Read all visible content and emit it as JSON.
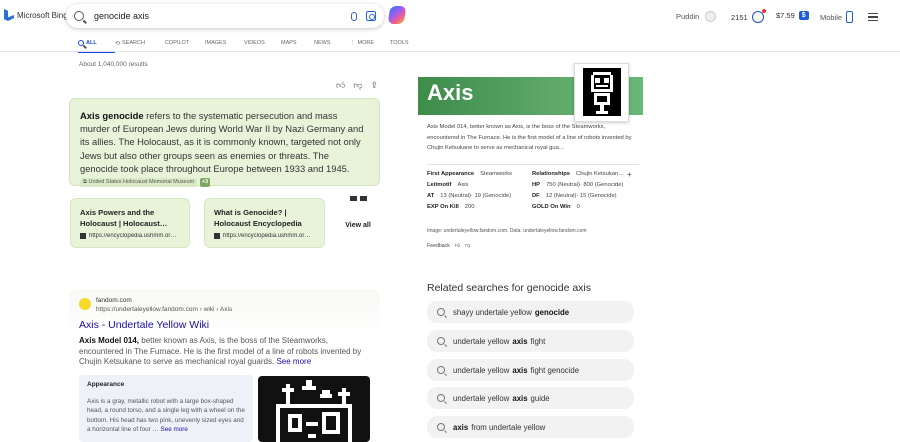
{
  "header": {
    "logo_text": "Microsoft Bing",
    "query": "genocide axis",
    "user_name": "Puddin",
    "rewards_points": "2151",
    "balance": "$7.59",
    "balance_badge": "$",
    "mobile_label": "Mobile"
  },
  "tabs": [
    {
      "label": "ALL",
      "icon": "search-icon"
    },
    {
      "label": "SEARCH",
      "icon": "copilot-search-icon"
    },
    {
      "label": "COPILOT",
      "icon": ""
    },
    {
      "label": "IMAGES",
      "icon": ""
    },
    {
      "label": "VIDEOS",
      "icon": ""
    },
    {
      "label": "MAPS",
      "icon": ""
    },
    {
      "label": "NEWS",
      "icon": ""
    },
    {
      "label": "MORE",
      "icon": "more-vertical-icon"
    },
    {
      "label": "TOOLS",
      "icon": ""
    }
  ],
  "results_count": "About 1,040,000 results",
  "answer": {
    "term": "Axis genocide",
    "text": " refers to the systematic persecution and mass murder of European Jews during World War II by Nazi Germany and its allies. The Holocaust, as it is commonly known, targeted not only Jews but also other groups seen as enemies or threats. The genocide took place throughout Europe between 1933 and 1945.",
    "source": "United States Holocaust Memorial Museum",
    "more": "+3"
  },
  "cards": [
    {
      "title": "Axis Powers and the Holocaust | Holocaust…",
      "url": "https://encyclopedia.ushmm.or…"
    },
    {
      "title": "What is Genocide? | Holocaust Encyclopedia",
      "url": "https://encyclopedia.ushmm.or…"
    }
  ],
  "view_all": "View all",
  "result": {
    "site": "fandom.com",
    "url": "https://undertaleyellow.fandom.com › wiki › Axis",
    "title": "Axis - Undertale Yellow Wiki",
    "snippet_bold": "Axis Model 014,",
    "snippet": " better known as Axis, is the boss of the Steamworks, encountered in The Furnace. He is the first model of a line of robots invented by Chujin Ketsukane to serve as mechanical royal guards.",
    "see_more": "See more",
    "appearance_heading": "Appearance",
    "appearance_text": "Axis is a gray, metallic robot with a large box-shaped head, a round torso, and a single leg with a wheel on the bottom. His head has two pink, unevenly sized eyes and a horizontal line of four …",
    "appearance_see_more": "See more"
  },
  "knowledge_panel": {
    "title": "Axis",
    "description": "Axis Model 014, better known as Axis, is the boss of the Steamworks, encountered in The Furnace. He is the first model of a line of robots invented by Chujin Ketsukane to serve as mechanical royal gua…",
    "facts": [
      {
        "label": "First Appearance",
        "value": "Steamworks"
      },
      {
        "label": "Relationships",
        "value": "Chujin Ketsukan…"
      },
      {
        "label": "Leitmotif",
        "value": "Axis"
      },
      {
        "label": "HP",
        "value": "750 (Neutral)· 800 (Genocide)"
      },
      {
        "label": "AT",
        "value": "13 (Neutral)· 19 (Genocide)"
      },
      {
        "label": "DF",
        "value": "12 (Neutral)· 15 (Genocide)"
      },
      {
        "label": "EXP On Kill",
        "value": "200"
      },
      {
        "label": "GOLD On Win",
        "value": "0"
      }
    ],
    "expand": "+",
    "credit": "Image: undertaleyellow.fandom.com. Data: undertaleyellow.fandom.com",
    "feedback": "Feedback"
  },
  "related": {
    "heading": "Related searches for genocide axis",
    "items": [
      {
        "pre": "shayy undertale yellow",
        "bold": "genocide",
        "post": ""
      },
      {
        "pre": "undertale yellow",
        "bold": "axis",
        "post": "fight"
      },
      {
        "pre": "undertale yellow",
        "bold": "axis",
        "post": "fight genocide"
      },
      {
        "pre": "undertale yellow",
        "bold": "axis",
        "post": "guide"
      },
      {
        "pre": "",
        "bold": "axis",
        "post": "from undertale yellow"
      }
    ]
  }
}
